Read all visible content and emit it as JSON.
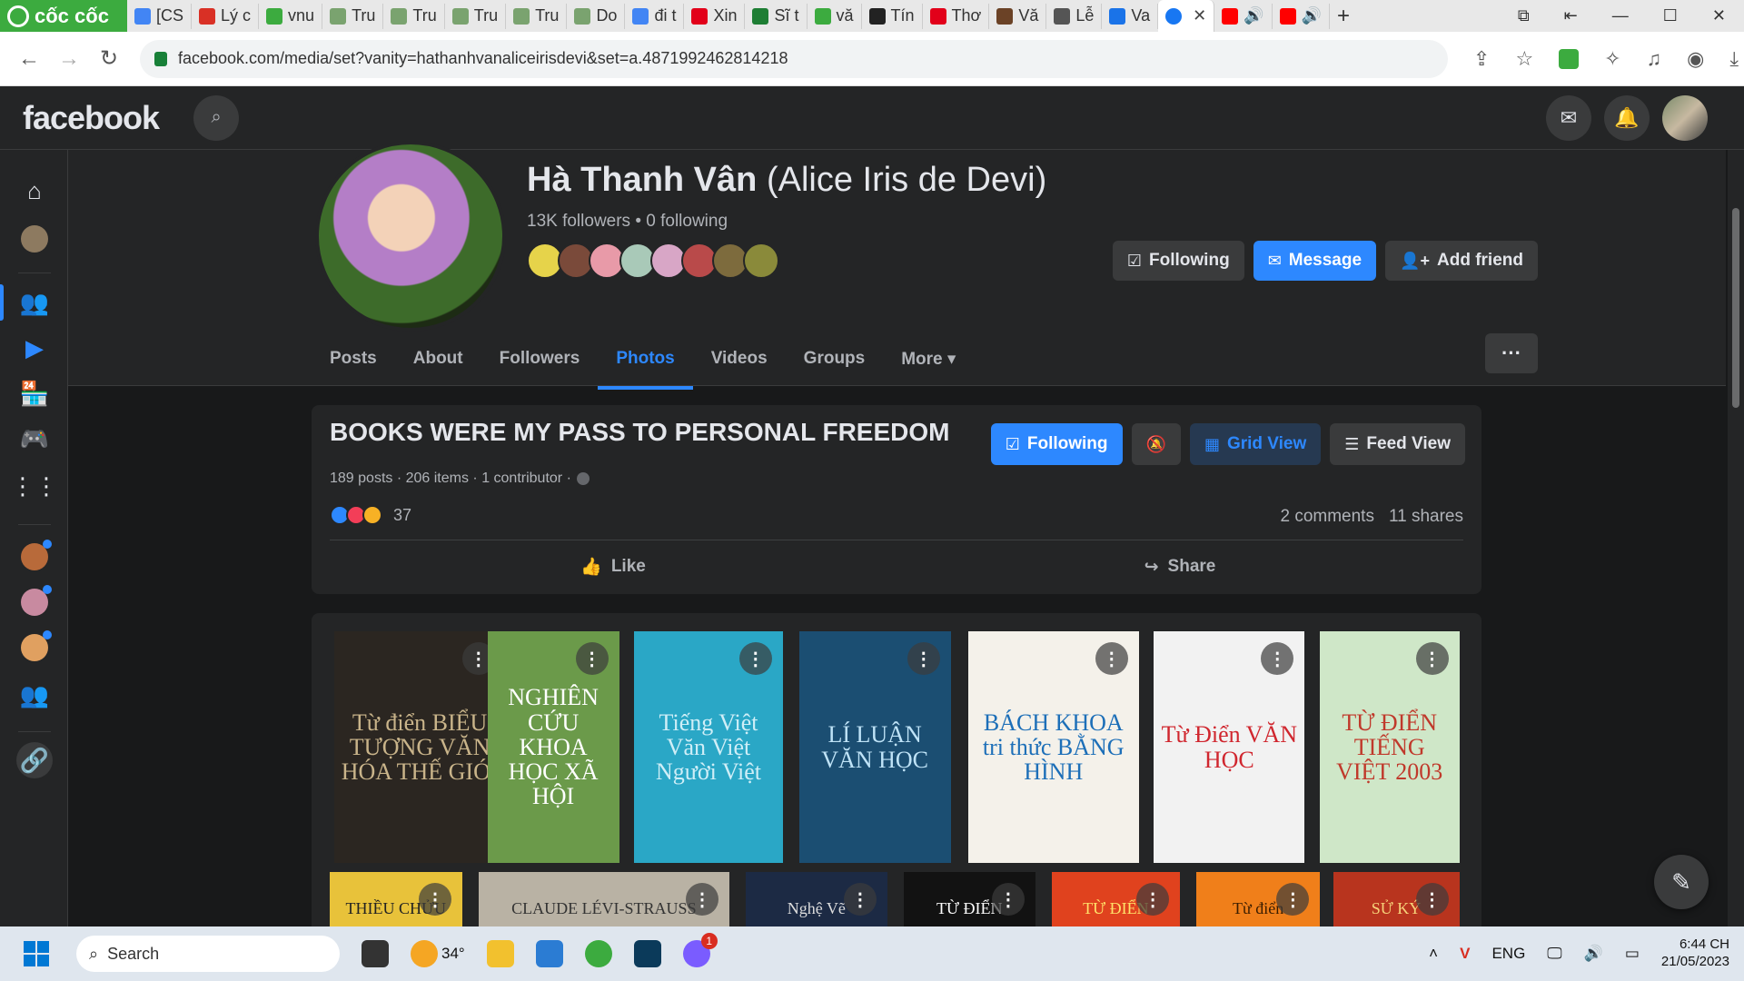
{
  "browser": {
    "brand": "cốc cốc",
    "tabs": [
      {
        "label": "[CS",
        "color": "#4285f4"
      },
      {
        "label": "Lý c",
        "color": "#d93025"
      },
      {
        "label": "vnu",
        "color": "#3cab3f"
      },
      {
        "label": "Tru",
        "color": "#7aa36f"
      },
      {
        "label": "Tru",
        "color": "#7aa36f"
      },
      {
        "label": "Tru",
        "color": "#7aa36f"
      },
      {
        "label": "Tru",
        "color": "#7aa36f"
      },
      {
        "label": "Do",
        "color": "#7aa36f"
      },
      {
        "label": "đi t",
        "color": "#4285f4"
      },
      {
        "label": "Xin",
        "color": "#e2001a"
      },
      {
        "label": "Sĩ t",
        "color": "#1e7e34"
      },
      {
        "label": "vă",
        "color": "#3cab3f"
      },
      {
        "label": "Tín",
        "color": "#222222"
      },
      {
        "label": "Thơ",
        "color": "#e2001a"
      },
      {
        "label": "Vă",
        "color": "#6b4226"
      },
      {
        "label": "Lễ",
        "color": "#555555"
      },
      {
        "label": "Va",
        "color": "#1a73e8"
      }
    ],
    "url": "facebook.com/media/set?vanity=hathanhvanaliceirisdevi&set=a.4871992462814218"
  },
  "fb": {
    "logo": "facebook",
    "profile": {
      "name": "Hà Thanh Vân",
      "alt_name": "(Alice Iris de Devi)",
      "followers": "13K followers • 0 following",
      "buttons": {
        "following": "Following",
        "message": "Message",
        "add_friend": "Add friend"
      },
      "friend_colors": [
        "#e6d34a",
        "#7a4a3a",
        "#e89aa8",
        "#a9c9b8",
        "#d8a6c6",
        "#b94a4a",
        "#7d6b3d",
        "#8a8a3a"
      ]
    },
    "tabs": [
      "Posts",
      "About",
      "Followers",
      "Photos",
      "Videos",
      "Groups",
      "More ▾"
    ],
    "album": {
      "title": "BOOKS WERE MY PASS TO PERSONAL FREEDOM",
      "meta": "189 posts · 206 items · 1 contributor ·",
      "btn_following": "Following",
      "btn_grid": "Grid View",
      "btn_feed": "Feed View",
      "reaction_count": "37",
      "comments": "2 comments",
      "shares": "11 shares",
      "like": "Like",
      "share": "Share"
    },
    "photos": [
      {
        "title": "Từ điển BIỂU TƯỢNG VĂN HÓA THẾ GIỚI",
        "bg": "#2b2621",
        "fg": "#c9b48a"
      },
      {
        "title": "NGHIÊN CỨU KHOA HỌC XÃ HỘI",
        "bg": "#6b9a4a",
        "fg": "#ffffff"
      },
      {
        "title": "Tiếng Việt Văn Việt Người Việt",
        "bg": "#2aa7c6",
        "fg": "#cfeef7"
      },
      {
        "title": "LÍ LUẬN VĂN HỌC",
        "bg": "#1b4e72",
        "fg": "#bfe3f7"
      },
      {
        "title": "BÁCH KHOA tri thức BẰNG HÌNH",
        "bg": "#f4f1ea",
        "fg": "#1d6fb8"
      },
      {
        "title": "Từ Điển VĂN HỌC",
        "bg": "#f2f2f2",
        "fg": "#d0262e"
      },
      {
        "title": "TỪ ĐIỂN TIẾNG VIỆT 2003",
        "bg": "#cfe7c8",
        "fg": "#c0392b"
      },
      {
        "title": "THIỀU CHỬU",
        "bg": "#e8c23a",
        "fg": "#222222"
      },
      {
        "title": "CLAUDE LÉVI-STRAUSS",
        "bg": "#b9b2a4",
        "fg": "#333333"
      },
      {
        "title": "Nghệ Vẽ",
        "bg": "#1c2a44",
        "fg": "#dddddd"
      },
      {
        "title": "TỪ ĐIỂN",
        "bg": "#121212",
        "fg": "#ffffff"
      },
      {
        "title": "TỪ ĐIỂN",
        "bg": "#e0421e",
        "fg": "#ffe26a"
      },
      {
        "title": "Từ điển",
        "bg": "#f07f1a",
        "fg": "#3a1d00"
      },
      {
        "title": "SỬ KÝ",
        "bg": "#b8341e",
        "fg": "#f6d27a"
      }
    ]
  },
  "taskbar": {
    "search": "Search",
    "weather": "34°",
    "badge": "1",
    "lang": "ENG",
    "time": "6:44 CH",
    "date": "21/05/2023"
  }
}
